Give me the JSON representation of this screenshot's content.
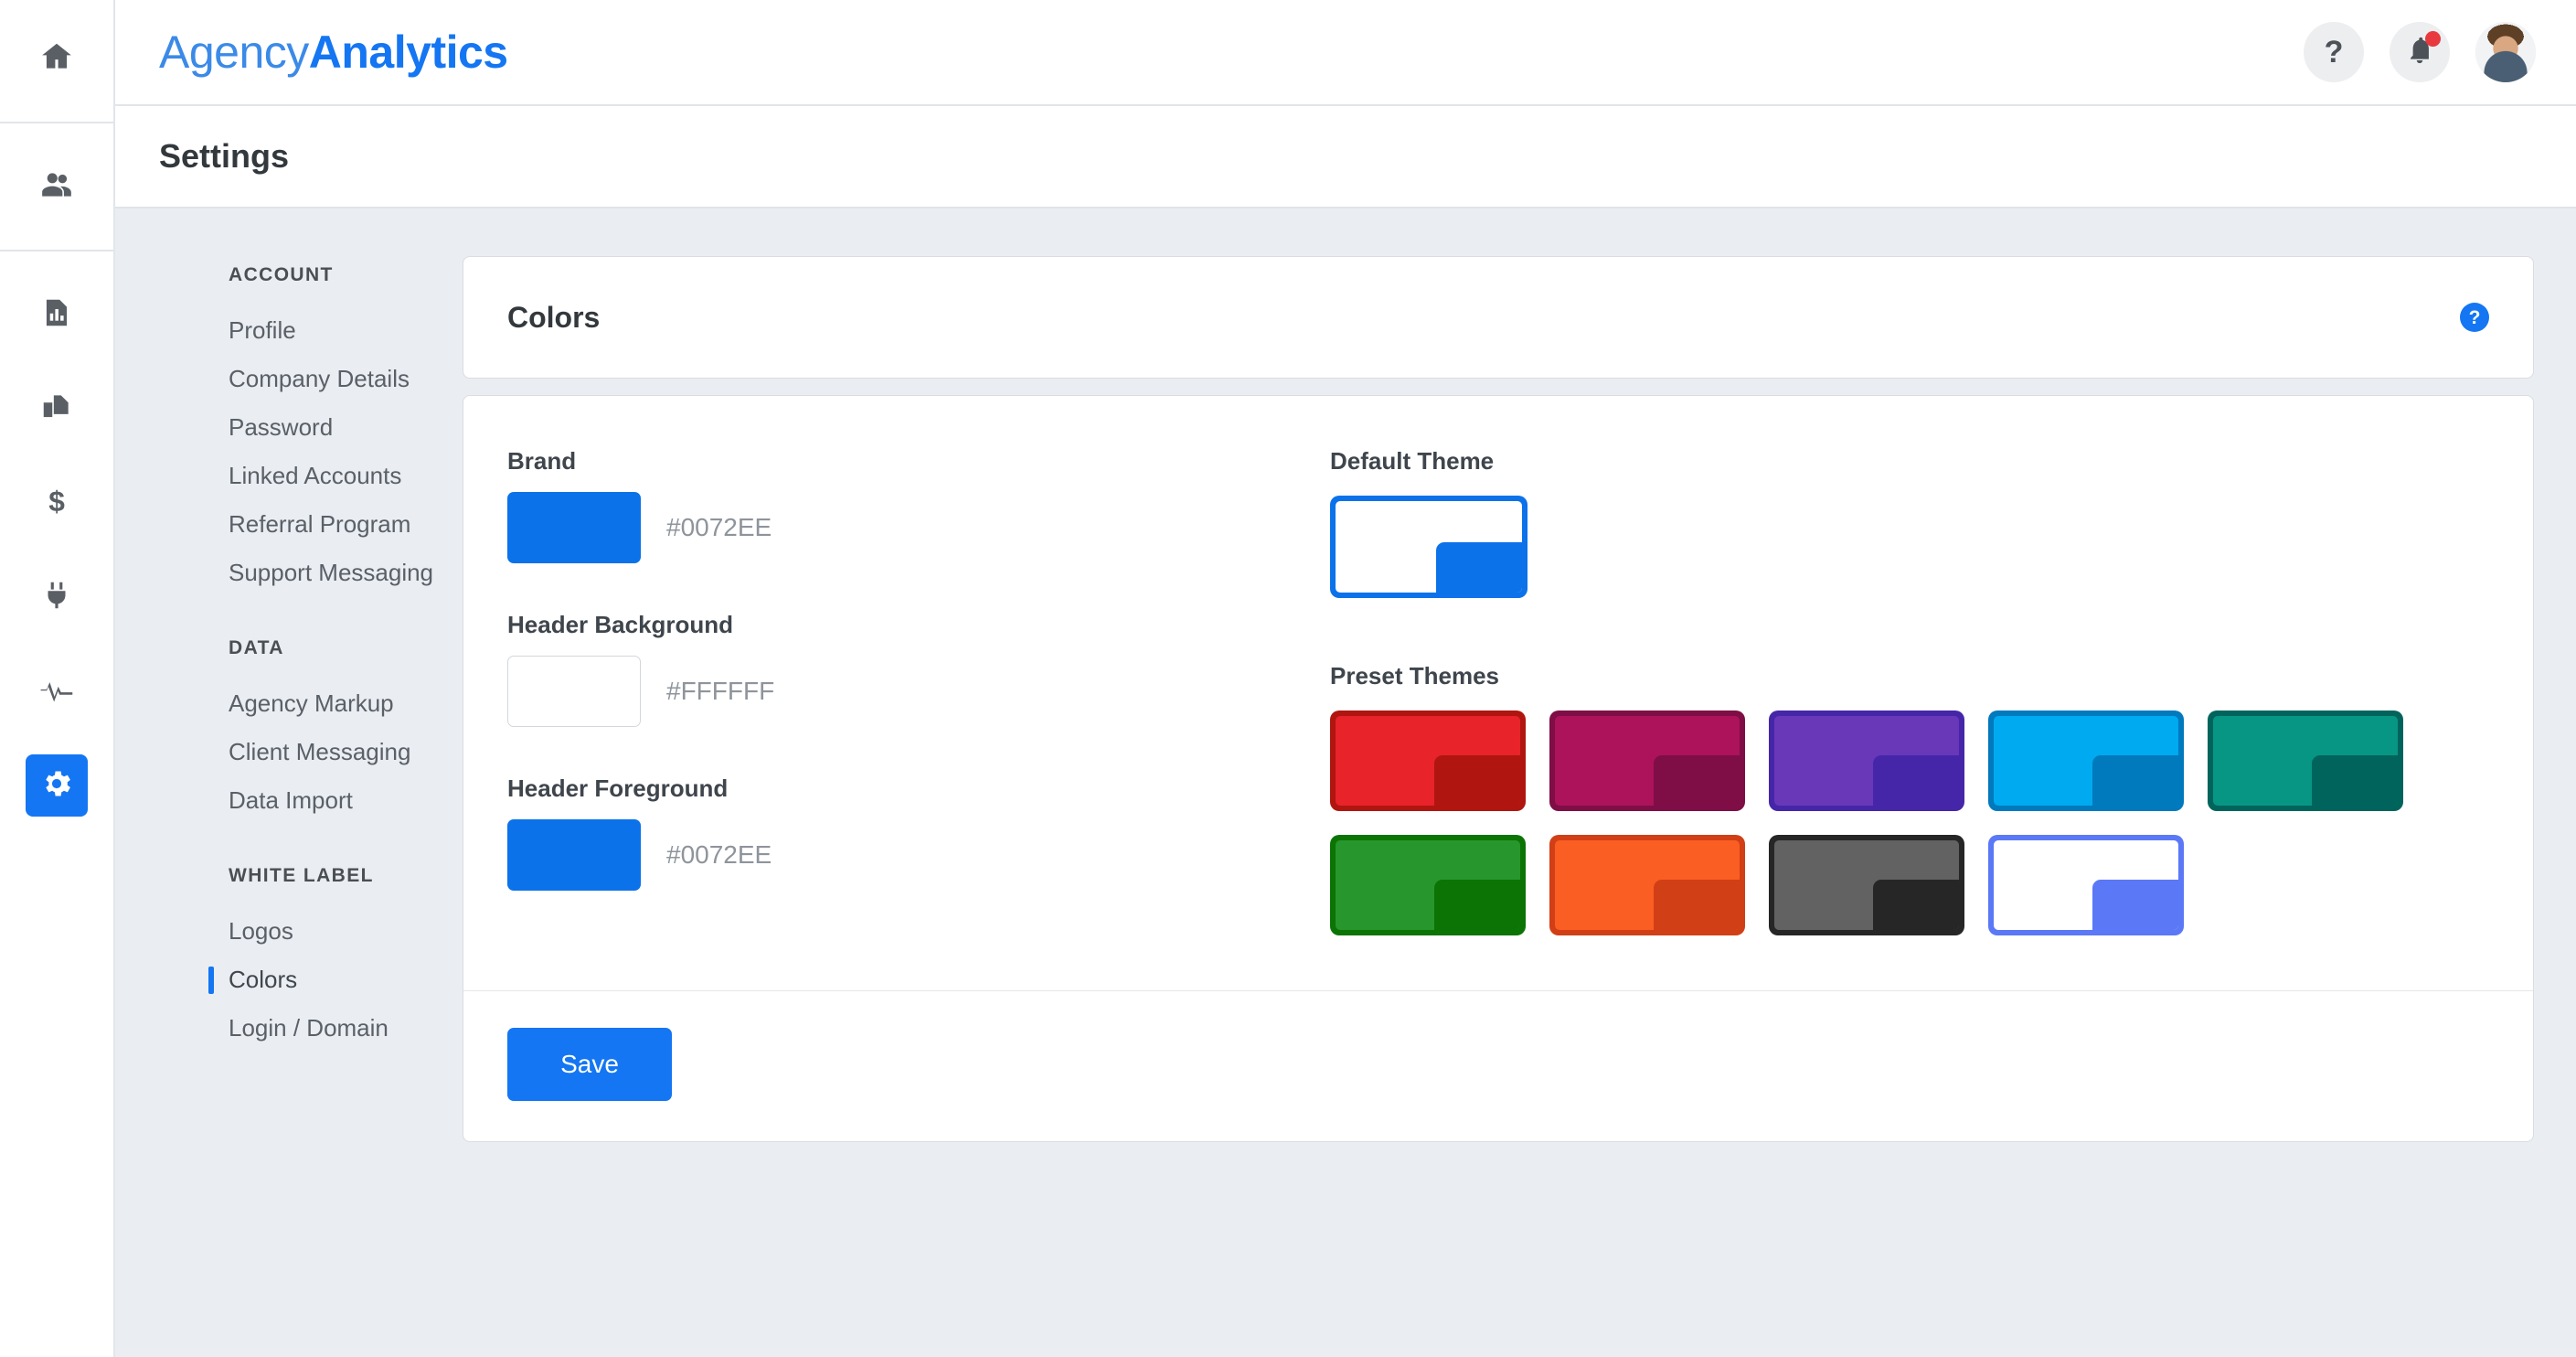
{
  "brand": {
    "name_light": "Agency",
    "name_bold": "Analytics",
    "accent": "#1476F2"
  },
  "topbar": {
    "help_label": "?",
    "notifications_label": "notifications",
    "avatar_label": "user avatar"
  },
  "page": {
    "title": "Settings"
  },
  "settings_nav": {
    "groups": [
      {
        "title": "ACCOUNT",
        "items": [
          {
            "label": "Profile",
            "active": false
          },
          {
            "label": "Company Details",
            "active": false
          },
          {
            "label": "Password",
            "active": false
          },
          {
            "label": "Linked Accounts",
            "active": false
          },
          {
            "label": "Referral Program",
            "active": false
          },
          {
            "label": "Support Messaging",
            "active": false
          }
        ]
      },
      {
        "title": "DATA",
        "items": [
          {
            "label": "Agency Markup",
            "active": false
          },
          {
            "label": "Client Messaging",
            "active": false
          },
          {
            "label": "Data Import",
            "active": false
          }
        ]
      },
      {
        "title": "WHITE LABEL",
        "items": [
          {
            "label": "Logos",
            "active": false
          },
          {
            "label": "Colors",
            "active": true
          },
          {
            "label": "Login / Domain",
            "active": false
          }
        ]
      }
    ]
  },
  "colors_card": {
    "title": "Colors",
    "help_icon_label": "?",
    "fields": [
      {
        "label": "Brand",
        "hex": "#0072EE",
        "swatch_color": "#0C72EA",
        "outlined": false
      },
      {
        "label": "Header Background",
        "hex": "#FFFFFF",
        "swatch_color": "#FFFFFF",
        "outlined": true
      },
      {
        "label": "Header Foreground",
        "hex": "#0072EE",
        "swatch_color": "#0C72EA",
        "outlined": false
      }
    ],
    "default_theme": {
      "label": "Default Theme",
      "frame": "#0C72EA",
      "inner": "#FFFFFF",
      "corner": "#0C72EA"
    },
    "preset_themes": {
      "label": "Preset Themes",
      "items": [
        {
          "name": "red",
          "frame": "#B01510",
          "inner": "#E8232A",
          "corner": "#B01510",
          "outline": false
        },
        {
          "name": "magenta",
          "frame": "#7E0E45",
          "inner": "#AC135A",
          "corner": "#7E0E45",
          "outline": false
        },
        {
          "name": "purple",
          "frame": "#4526A8",
          "inner": "#6938B8",
          "corner": "#4526A8",
          "outline": false
        },
        {
          "name": "cyan",
          "frame": "#0079BD",
          "inner": "#00AAF0",
          "corner": "#0079BD",
          "outline": false
        },
        {
          "name": "teal",
          "frame": "#00645C",
          "inner": "#089684",
          "corner": "#00645C",
          "outline": false
        },
        {
          "name": "green",
          "frame": "#0B7405",
          "inner": "#27962C",
          "corner": "#0B7405",
          "outline": false
        },
        {
          "name": "orange",
          "frame": "#D13F16",
          "inner": "#FA5E23",
          "corner": "#D13F16",
          "outline": false
        },
        {
          "name": "dark",
          "frame": "#262626",
          "inner": "#626262",
          "corner": "#262626",
          "outline": false
        },
        {
          "name": "white",
          "frame": "#5B78F6",
          "inner": "#FFFFFF",
          "corner": "#5B78F6",
          "outline": true
        }
      ]
    },
    "save_label": "Save"
  },
  "rail": {
    "items": [
      {
        "icon": "home-icon",
        "active": false
      },
      {
        "icon": "users-icon",
        "active": false
      },
      {
        "icon": "report-icon",
        "active": false
      },
      {
        "icon": "documents-icon",
        "active": false
      },
      {
        "icon": "dollar-icon",
        "active": false
      },
      {
        "icon": "plug-icon",
        "active": false
      },
      {
        "icon": "activity-icon",
        "active": false
      },
      {
        "icon": "gear-icon",
        "active": true
      }
    ]
  }
}
